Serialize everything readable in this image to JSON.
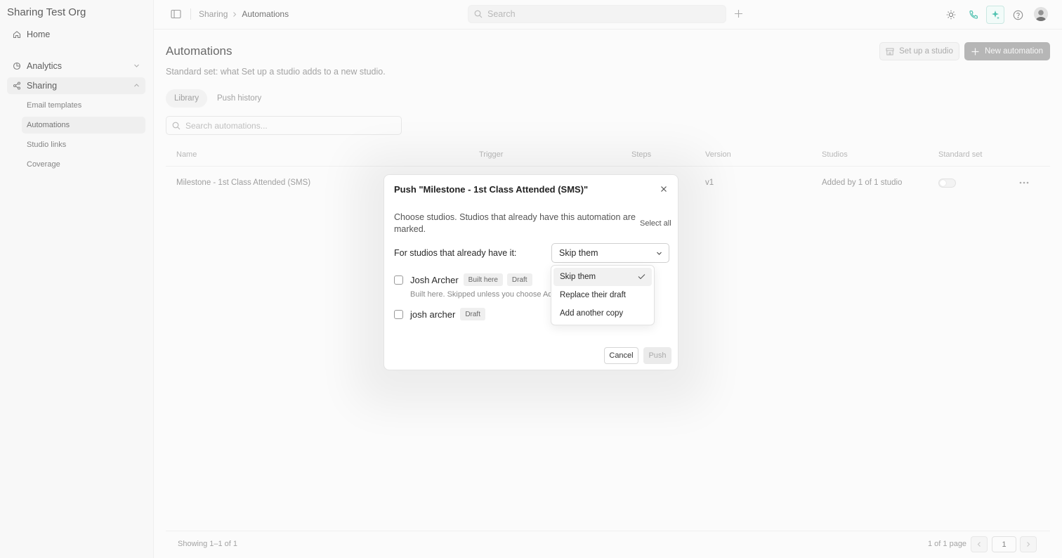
{
  "sidebar": {
    "org_name": "Sharing Test Org",
    "items": {
      "home": "Home",
      "analytics": "Analytics",
      "sharing": "Sharing"
    },
    "sub_items": {
      "email_templates": "Email templates",
      "automations": "Automations",
      "studio_links": "Studio links",
      "coverage": "Coverage"
    }
  },
  "topbar": {
    "breadcrumb": [
      "Sharing",
      "Automations"
    ],
    "search_placeholder": "Search"
  },
  "main": {
    "title": "Automations",
    "subtitle": "Standard set: what Set up a studio adds to a new studio.",
    "setup_button": "Set up a studio",
    "new_button": "New automation",
    "tabs": {
      "library": "Library",
      "history": "Push history"
    },
    "search_placeholder": "Search automations...",
    "columns": {
      "name": "Name",
      "trigger": "Trigger",
      "steps": "Steps",
      "version": "Version",
      "studios": "Studios",
      "standard": "Standard set"
    },
    "row": {
      "name": "Milestone - 1st Class Attended (SMS)",
      "version": "v1",
      "studios": "Added by 1 of 1 studio"
    },
    "footer": {
      "showing": "Showing 1–1 of 1",
      "pages": "1 of 1 page",
      "page_num": "1"
    }
  },
  "modal": {
    "title": "Push \"Milestone - 1st Class Attended (SMS)\"",
    "description": "Choose studios. Studios that already have this automation are marked.",
    "select_all": "Select all",
    "already_label": "For studios that already have it:",
    "dropdown_value": "Skip them",
    "studios": [
      {
        "name": "Josh Archer",
        "badges": [
          "Built here",
          "Draft"
        ],
        "note": "Built here. Skipped unless you choose Add"
      },
      {
        "name": "josh archer",
        "badges": [
          "Draft"
        ]
      }
    ],
    "cancel": "Cancel",
    "push": "Push"
  },
  "dropdown_menu": {
    "options": [
      "Skip them",
      "Replace their draft",
      "Add another copy"
    ],
    "selected": "Skip them"
  },
  "colors": {
    "accent_teal": "#2bb5a0",
    "primary_disabled": "#a6a6a6"
  }
}
